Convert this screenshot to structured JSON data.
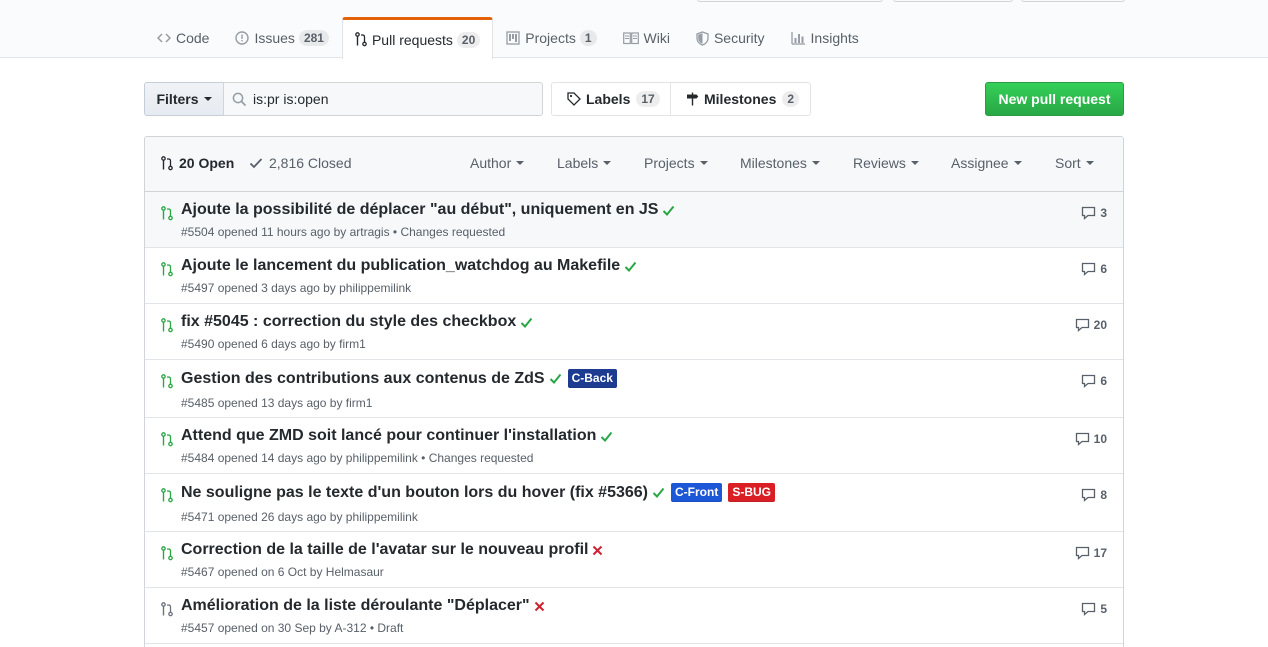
{
  "tabs": [
    {
      "label": "Code",
      "icon": "code-icon",
      "count": null,
      "selected": false
    },
    {
      "label": "Issues",
      "icon": "issue-icon",
      "count": "281",
      "selected": false
    },
    {
      "label": "Pull requests",
      "icon": "pull-request-icon",
      "count": "20",
      "selected": true
    },
    {
      "label": "Projects",
      "icon": "project-icon",
      "count": "1",
      "selected": false
    },
    {
      "label": "Wiki",
      "icon": "book-icon",
      "count": null,
      "selected": false
    },
    {
      "label": "Security",
      "icon": "shield-icon",
      "count": null,
      "selected": false
    },
    {
      "label": "Insights",
      "icon": "graph-icon",
      "count": null,
      "selected": false
    }
  ],
  "toolbar": {
    "filters_label": "Filters",
    "search_value": "is:pr is:open",
    "labels_label": "Labels",
    "labels_count": "17",
    "milestones_label": "Milestones",
    "milestones_count": "2",
    "new_pr_label": "New pull request"
  },
  "list_header": {
    "open_label": "20 Open",
    "closed_label": "2,816 Closed",
    "selects": [
      "Author",
      "Labels",
      "Projects",
      "Milestones",
      "Reviews",
      "Assignee",
      "Sort"
    ]
  },
  "colors": {
    "open_green": "#28a745",
    "fail_red": "#cb2431",
    "accent_orange": "#e36209",
    "button_green": "#28a745"
  },
  "pull_requests": [
    {
      "title": "Ajoute la possibilité de déplacer \"au début\", uniquement en JS",
      "status": "success",
      "labels": [],
      "meta": "#5504 opened 11 hours ago by artragis • Changes requested",
      "comments": "3",
      "draft": false
    },
    {
      "title": "Ajoute le lancement du publication_watchdog au Makefile",
      "status": "success",
      "labels": [],
      "meta": "#5497 opened 3 days ago by philippemilink",
      "comments": "6",
      "draft": false
    },
    {
      "title": "fix #5045 : correction du style des checkbox",
      "status": "success",
      "labels": [],
      "meta": "#5490 opened 6 days ago by firm1",
      "comments": "20",
      "draft": false
    },
    {
      "title": "Gestion des contributions aux contenus de ZdS",
      "status": "success",
      "labels": [
        {
          "name": "C-Back",
          "color": "#1d3b91"
        }
      ],
      "meta": "#5485 opened 13 days ago by firm1",
      "comments": "6",
      "draft": false
    },
    {
      "title": "Attend que ZMD soit lancé pour continuer l'installation",
      "status": "success",
      "labels": [],
      "meta": "#5484 opened 14 days ago by philippemilink • Changes requested",
      "comments": "10",
      "draft": false
    },
    {
      "title": "Ne souligne pas le texte d'un bouton lors du hover (fix #5366)",
      "status": "success",
      "labels": [
        {
          "name": "C-Front",
          "color": "#1b57d6"
        },
        {
          "name": "S-BUG",
          "color": "#d91f24"
        }
      ],
      "meta": "#5471 opened 26 days ago by philippemilink",
      "comments": "8",
      "draft": false
    },
    {
      "title": "Correction de la taille de l'avatar sur le nouveau profil",
      "status": "failure",
      "labels": [],
      "meta": "#5467 opened on 6 Oct by Helmasaur",
      "comments": "17",
      "draft": false
    },
    {
      "title": "Amélioration de la liste déroulante \"Déplacer\"",
      "status": "failure",
      "labels": [],
      "meta": "#5457 opened on 30 Sep by A-312 • Draft",
      "comments": "5",
      "draft": true
    }
  ]
}
